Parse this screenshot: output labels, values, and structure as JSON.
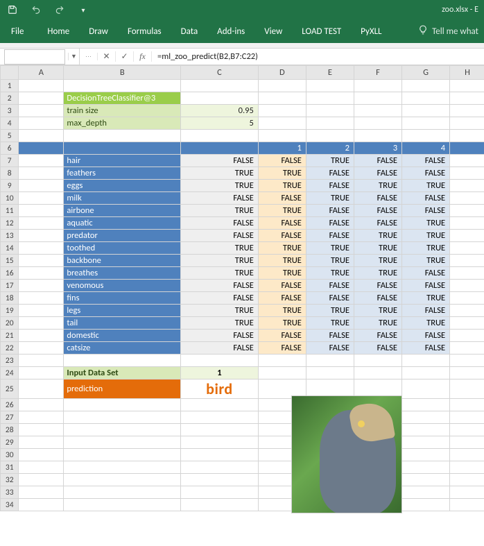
{
  "title_bar": {
    "filename": "zoo.xlsx - E"
  },
  "ribbon": {
    "tabs": [
      "File",
      "Home",
      "Draw",
      "Formulas",
      "Data",
      "Add-ins",
      "View",
      "LOAD TEST",
      "PyXLL"
    ],
    "tellme": "Tell me what"
  },
  "formula_bar": {
    "namebox": "",
    "formula": "=ml_zoo_predict(B2,B7:C22)"
  },
  "columns": [
    "A",
    "B",
    "C",
    "D",
    "E",
    "F",
    "G",
    "H"
  ],
  "row_count": 34,
  "model": {
    "name": "DecisionTreeClassifier@3",
    "params": [
      {
        "label": "train size",
        "value": "0.95"
      },
      {
        "label": "max_depth",
        "value": "5"
      }
    ]
  },
  "feature_header_numbers": [
    "",
    "",
    "1",
    "2",
    "3",
    "4"
  ],
  "features": [
    {
      "name": "hair",
      "vals": [
        "FALSE",
        "FALSE",
        "TRUE",
        "FALSE",
        "FALSE"
      ]
    },
    {
      "name": "feathers",
      "vals": [
        "TRUE",
        "TRUE",
        "FALSE",
        "FALSE",
        "FALSE"
      ]
    },
    {
      "name": "eggs",
      "vals": [
        "TRUE",
        "TRUE",
        "FALSE",
        "TRUE",
        "TRUE"
      ]
    },
    {
      "name": "milk",
      "vals": [
        "FALSE",
        "FALSE",
        "TRUE",
        "FALSE",
        "FALSE"
      ]
    },
    {
      "name": "airbone",
      "vals": [
        "TRUE",
        "TRUE",
        "FALSE",
        "FALSE",
        "FALSE"
      ]
    },
    {
      "name": "aquatic",
      "vals": [
        "FALSE",
        "FALSE",
        "FALSE",
        "FALSE",
        "TRUE"
      ]
    },
    {
      "name": "predator",
      "vals": [
        "FALSE",
        "FALSE",
        "FALSE",
        "TRUE",
        "TRUE"
      ]
    },
    {
      "name": "toothed",
      "vals": [
        "TRUE",
        "TRUE",
        "TRUE",
        "TRUE",
        "TRUE"
      ]
    },
    {
      "name": "backbone",
      "vals": [
        "TRUE",
        "TRUE",
        "TRUE",
        "TRUE",
        "TRUE"
      ]
    },
    {
      "name": "breathes",
      "vals": [
        "TRUE",
        "TRUE",
        "TRUE",
        "TRUE",
        "FALSE"
      ]
    },
    {
      "name": "venomous",
      "vals": [
        "FALSE",
        "FALSE",
        "FALSE",
        "FALSE",
        "FALSE"
      ]
    },
    {
      "name": "fins",
      "vals": [
        "FALSE",
        "FALSE",
        "FALSE",
        "FALSE",
        "TRUE"
      ]
    },
    {
      "name": "legs",
      "vals": [
        "TRUE",
        "TRUE",
        "TRUE",
        "TRUE",
        "FALSE"
      ]
    },
    {
      "name": "tail",
      "vals": [
        "TRUE",
        "TRUE",
        "TRUE",
        "TRUE",
        "TRUE"
      ]
    },
    {
      "name": "domestic",
      "vals": [
        "FALSE",
        "FALSE",
        "FALSE",
        "FALSE",
        "FALSE"
      ]
    },
    {
      "name": "catsize",
      "vals": [
        "FALSE",
        "FALSE",
        "FALSE",
        "FALSE",
        "FALSE"
      ]
    }
  ],
  "input_set": {
    "label": "Input Data Set",
    "value": "1"
  },
  "prediction": {
    "label": "prediction",
    "value": "bird"
  }
}
